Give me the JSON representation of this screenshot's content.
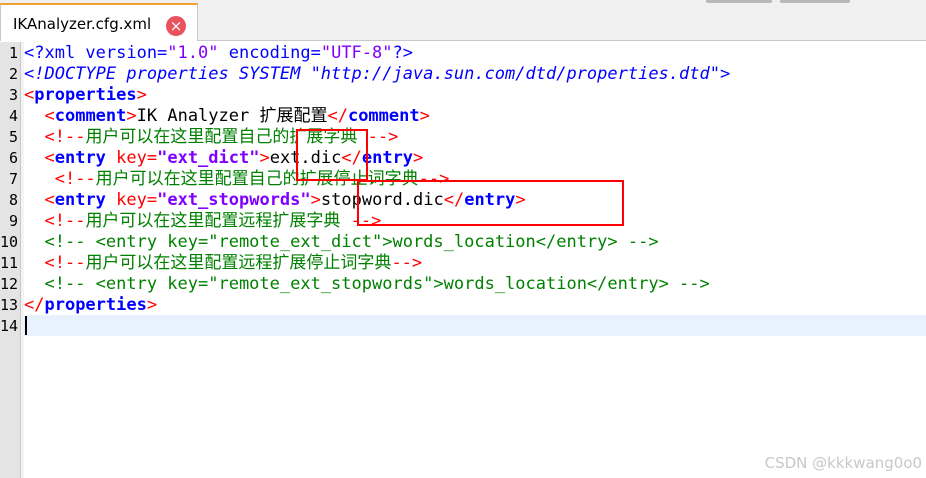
{
  "tab": {
    "title": "IKAnalyzer.cfg.xml",
    "close_glyph": "×"
  },
  "gutter": {
    "line_numbers": [
      "1",
      "2",
      "3",
      "4",
      "5",
      "6",
      "7",
      "8",
      "9",
      "10",
      "11",
      "12",
      "13",
      "14"
    ]
  },
  "code": {
    "l1_a": "<?xml version=",
    "l1_b": "\"1.0\"",
    "l1_c": " encoding=",
    "l1_d": "\"UTF-8\"",
    "l1_e": "?>",
    "l2": "<!DOCTYPE properties SYSTEM \"http://java.sun.com/dtd/properties.dtd\">",
    "lt": "<",
    "gt": ">",
    "lt_slash": "</",
    "properties": "properties",
    "comment_tag": "comment",
    "entry_tag": "entry",
    "key_attr": " key=",
    "indent": "  ",
    "indent_l7": "   ",
    "l4_text": "IK Analyzer 扩展配置",
    "comment_open": "<!--",
    "comment_close": "-->",
    "comment_close_sp": " -->",
    "l5_comment": "用户可以在这里配置自己的扩展字典",
    "l6_key": "\"ext_dict\"",
    "l6_value": "ext.dic",
    "l7_comment": "用户可以在这里配置自己的扩展停止词字典",
    "l8_key": "\"ext_stopwords\"",
    "l8_value": "stopword.dic",
    "l9_comment": "用户可以在这里配置远程扩展字典",
    "l10_comment": "<!-- <entry key=\"remote_ext_dict\">words_location</entry> -->",
    "l11_comment": "用户可以在这里配置远程扩展停止词字典",
    "l12_comment": "<!-- <entry key=\"remote_ext_stopwords\">words_location</entry> -->"
  },
  "watermark": "CSDN @kkkwang0o0"
}
